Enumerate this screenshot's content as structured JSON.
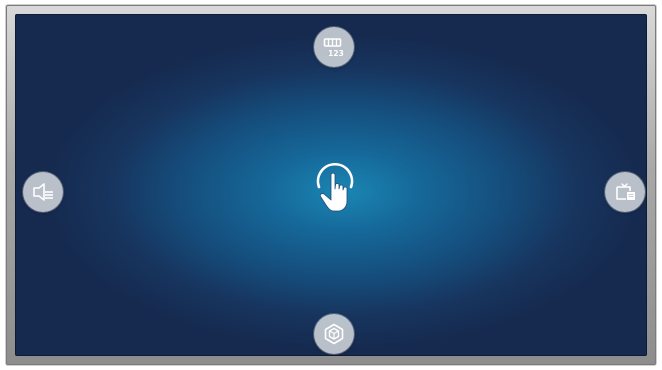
{
  "screen": {
    "background_accent": "#1b86b3",
    "background_edge": "#162a4f",
    "frame_color": "#a9a9a9"
  },
  "icons": {
    "top": {
      "name": "keypad-123-icon",
      "glyph_text": "123"
    },
    "bottom": {
      "name": "cube-icon"
    },
    "left": {
      "name": "speaker-menu-icon"
    },
    "right": {
      "name": "tv-source-icon"
    },
    "center": {
      "name": "pointing-hand-icon"
    }
  }
}
